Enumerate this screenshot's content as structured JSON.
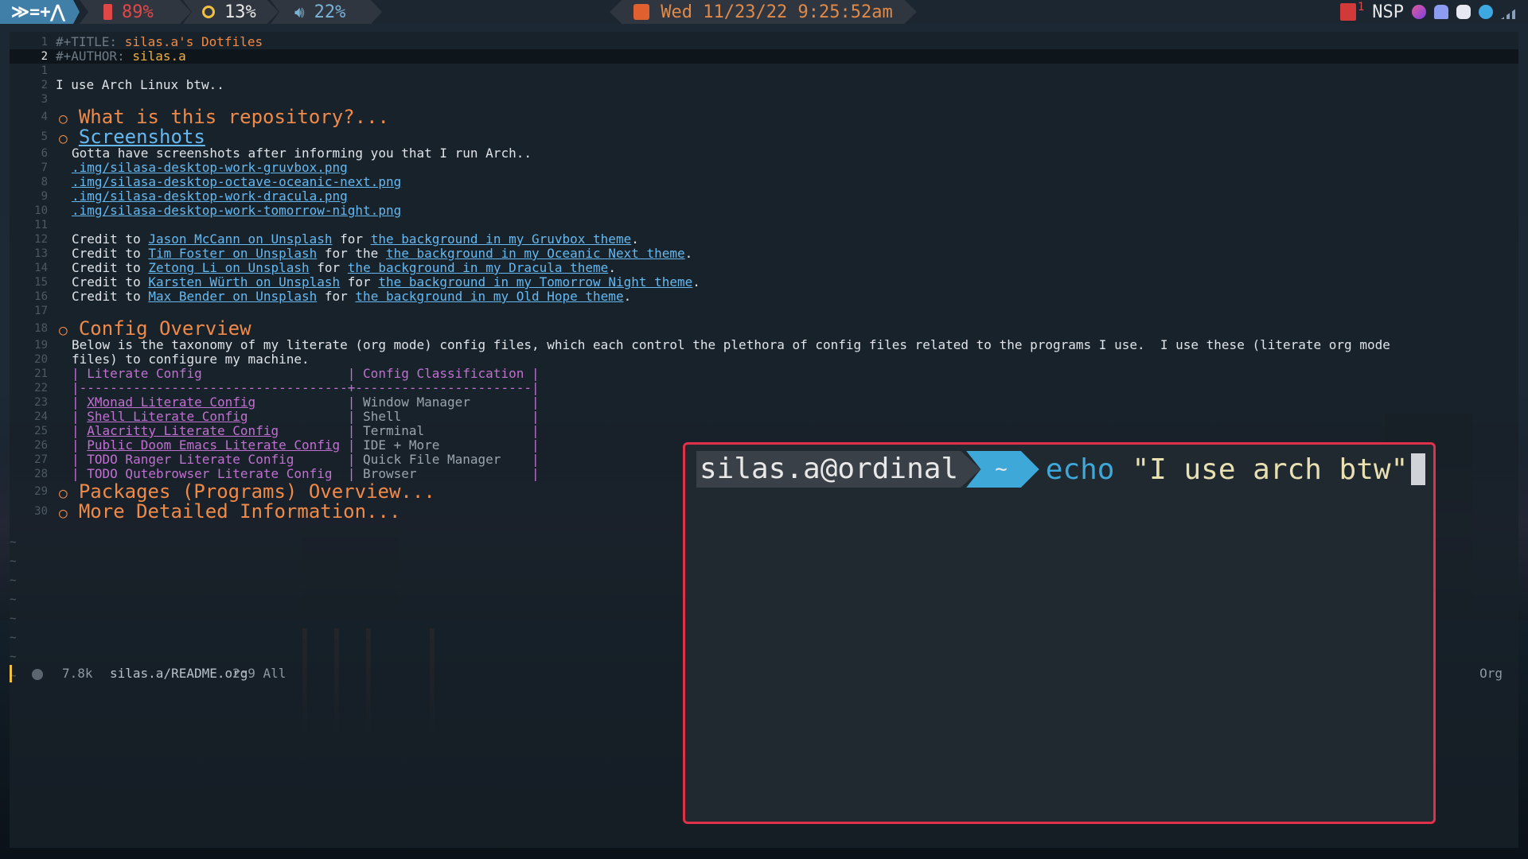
{
  "topbar": {
    "logo": "≫=+⋀",
    "battery": "89%",
    "brightness": "13%",
    "volume": "22%",
    "clock": "Wed 11/23/22 9:25:52am",
    "notif_count": "1",
    "workspace": "NSP",
    "colors": {
      "accent": "#3f7fa8",
      "battery": "#e04848",
      "volume": "#79b3d8",
      "clock": "#e08a4a"
    }
  },
  "editor": {
    "lines": [
      {
        "n": "1",
        "parts": [
          {
            "t": "#+TITLE: ",
            "c": "meta"
          },
          {
            "t": "silas.a's Dotfiles",
            "c": "orange"
          }
        ]
      },
      {
        "n": "2",
        "current": true,
        "parts": [
          {
            "t": "#+AUTHOR: ",
            "c": "meta"
          },
          {
            "t": "silas.a",
            "c": "yellow"
          }
        ]
      },
      {
        "n": "1",
        "parts": []
      },
      {
        "n": "2",
        "parts": [
          {
            "t": "I use Arch Linux btw..",
            "c": "plain"
          }
        ]
      },
      {
        "n": "3",
        "parts": []
      },
      {
        "n": "4",
        "heading": true,
        "parts": [
          {
            "t": "What is this repository?...",
            "c": "heading"
          }
        ]
      },
      {
        "n": "5",
        "heading": true,
        "parts": [
          {
            "t": "Screenshots",
            "c": "heading-link"
          }
        ]
      },
      {
        "n": "6",
        "indent": true,
        "parts": [
          {
            "t": "Gotta have screenshots after informing you that I run Arch..",
            "c": "plain"
          }
        ]
      },
      {
        "n": "7",
        "indent": true,
        "parts": [
          {
            "t": ".img/silasa-desktop-work-gruvbox.png",
            "c": "lnk"
          }
        ]
      },
      {
        "n": "8",
        "indent": true,
        "parts": [
          {
            "t": ".img/silasa-desktop-octave-oceanic-next.png",
            "c": "lnk"
          }
        ]
      },
      {
        "n": "9",
        "indent": true,
        "parts": [
          {
            "t": ".img/silasa-desktop-work-dracula.png",
            "c": "lnk"
          }
        ]
      },
      {
        "n": "10",
        "indent": true,
        "parts": [
          {
            "t": ".img/silasa-desktop-work-tomorrow-night.png",
            "c": "lnk"
          }
        ]
      },
      {
        "n": "11",
        "parts": []
      },
      {
        "n": "12",
        "indent": true,
        "parts": [
          {
            "t": "Credit to ",
            "c": "plain"
          },
          {
            "t": "Jason McCann on Unsplash",
            "c": "lnk"
          },
          {
            "t": " for ",
            "c": "plain"
          },
          {
            "t": "the background in my Gruvbox theme",
            "c": "lnk"
          },
          {
            "t": ".",
            "c": "plain"
          }
        ]
      },
      {
        "n": "13",
        "indent": true,
        "parts": [
          {
            "t": "Credit to ",
            "c": "plain"
          },
          {
            "t": "Tim Foster on Unsplash",
            "c": "lnk"
          },
          {
            "t": " for the ",
            "c": "plain"
          },
          {
            "t": "the background in my Oceanic Next theme",
            "c": "lnk"
          },
          {
            "t": ".",
            "c": "plain"
          }
        ]
      },
      {
        "n": "14",
        "indent": true,
        "parts": [
          {
            "t": "Credit to ",
            "c": "plain"
          },
          {
            "t": "Zetong Li on Unsplash",
            "c": "lnk"
          },
          {
            "t": " for ",
            "c": "plain"
          },
          {
            "t": "the background in my Dracula theme",
            "c": "lnk"
          },
          {
            "t": ".",
            "c": "plain"
          }
        ]
      },
      {
        "n": "15",
        "indent": true,
        "parts": [
          {
            "t": "Credit to ",
            "c": "plain"
          },
          {
            "t": "Karsten Würth on Unsplash",
            "c": "lnk"
          },
          {
            "t": " for ",
            "c": "plain"
          },
          {
            "t": "the background in my Tomorrow Night theme",
            "c": "lnk"
          },
          {
            "t": ".",
            "c": "plain"
          }
        ]
      },
      {
        "n": "16",
        "indent": true,
        "parts": [
          {
            "t": "Credit to ",
            "c": "plain"
          },
          {
            "t": "Max Bender on Unsplash",
            "c": "lnk"
          },
          {
            "t": " for ",
            "c": "plain"
          },
          {
            "t": "the background in my Old Hope theme",
            "c": "lnk"
          },
          {
            "t": ".",
            "c": "plain"
          }
        ]
      },
      {
        "n": "17",
        "parts": []
      },
      {
        "n": "18",
        "heading": true,
        "parts": [
          {
            "t": "Config Overview",
            "c": "heading"
          }
        ]
      },
      {
        "n": "19",
        "indent": true,
        "parts": [
          {
            "t": "Below is the taxonomy of my literate (org mode) config files, which each control the plethora of config files related to the programs I use.  I use these (literate org mode",
            "c": "plain"
          }
        ]
      },
      {
        "n": "20",
        "indent": true,
        "parts": [
          {
            "t": "files) to configure my machine.",
            "c": "plain"
          }
        ]
      },
      {
        "n": "21",
        "indent": true,
        "parts": [
          {
            "t": "| Literate Config                   | Config Classification |",
            "c": "tbl"
          }
        ]
      },
      {
        "n": "22",
        "indent": true,
        "parts": [
          {
            "t": "|-----------------------------------+-----------------------|",
            "c": "tbl"
          }
        ]
      },
      {
        "n": "23",
        "indent": true,
        "parts": [
          {
            "t": "| ",
            "c": "tbl"
          },
          {
            "t": "XMonad Literate Config",
            "c": "tblk"
          },
          {
            "t": "            | ",
            "c": "tbl"
          },
          {
            "t": "Window Manager",
            "c": "tblp"
          },
          {
            "t": "        |",
            "c": "tbl"
          }
        ]
      },
      {
        "n": "24",
        "indent": true,
        "parts": [
          {
            "t": "| ",
            "c": "tbl"
          },
          {
            "t": "Shell Literate Config",
            "c": "tblk"
          },
          {
            "t": "             | ",
            "c": "tbl"
          },
          {
            "t": "Shell",
            "c": "tblp"
          },
          {
            "t": "                 |",
            "c": "tbl"
          }
        ]
      },
      {
        "n": "25",
        "indent": true,
        "parts": [
          {
            "t": "| ",
            "c": "tbl"
          },
          {
            "t": "Alacritty Literate Config",
            "c": "tblk"
          },
          {
            "t": "         | ",
            "c": "tbl"
          },
          {
            "t": "Terminal",
            "c": "tblp"
          },
          {
            "t": "              |",
            "c": "tbl"
          }
        ]
      },
      {
        "n": "26",
        "indent": true,
        "parts": [
          {
            "t": "| ",
            "c": "tbl"
          },
          {
            "t": "Public Doom Emacs Literate Config",
            "c": "tblk"
          },
          {
            "t": " | ",
            "c": "tbl"
          },
          {
            "t": "IDE + More",
            "c": "tblp"
          },
          {
            "t": "            |",
            "c": "tbl"
          }
        ]
      },
      {
        "n": "27",
        "indent": true,
        "parts": [
          {
            "t": "| TODO Ranger Literate Config       | ",
            "c": "tbl"
          },
          {
            "t": "Quick File Manager",
            "c": "tblp"
          },
          {
            "t": "    |",
            "c": "tbl"
          }
        ]
      },
      {
        "n": "28",
        "indent": true,
        "parts": [
          {
            "t": "| TODO Qutebrowser Literate Config  | ",
            "c": "tbl"
          },
          {
            "t": "Browser",
            "c": "tblp"
          },
          {
            "t": "               |",
            "c": "tbl"
          }
        ]
      },
      {
        "n": "29",
        "heading": true,
        "parts": [
          {
            "t": "Packages (Programs) Overview...",
            "c": "heading"
          }
        ]
      },
      {
        "n": "30",
        "heading": true,
        "parts": [
          {
            "t": "More Detailed Information...",
            "c": "heading"
          }
        ]
      }
    ],
    "bullet": "○",
    "tilde": "~"
  },
  "modeline": {
    "size": "7.8k",
    "file": "silas.a/README.org",
    "position": "2:9 All",
    "mode": "Org"
  },
  "terminal": {
    "user_host": "silas.a@ordinal",
    "dir": "~",
    "command": "echo",
    "argument": "\"I use arch btw\"",
    "border_color": "#e0304a"
  }
}
